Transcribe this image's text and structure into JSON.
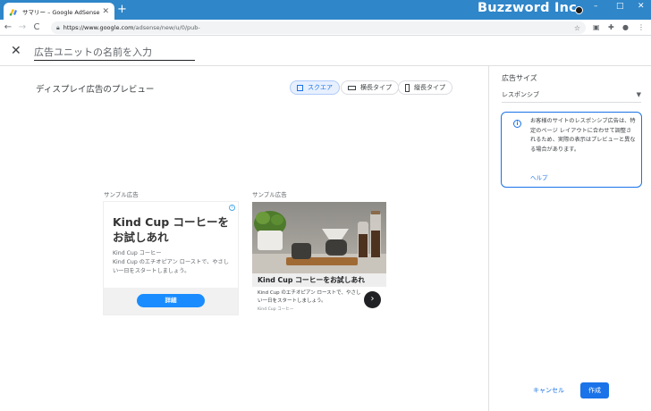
{
  "browser": {
    "tab_title": "サマリー – Google AdSense",
    "new_tab_symbol": "+",
    "url_domain": "https://www.google.com",
    "url_path": "/adsense/new/u/0/pub-",
    "brand_watermark": "Buzzword Inc.",
    "window_controls": [
      "–",
      "□",
      "✕"
    ],
    "nav": {
      "back": "←",
      "forward": "→",
      "reload": "C"
    }
  },
  "header": {
    "close_symbol": "✕",
    "name_placeholder": "広告ユニットの名前を入力"
  },
  "preview": {
    "title": "ディスプレイ広告のプレビュー",
    "shape_options": [
      {
        "label": "スクエア",
        "selected": true
      },
      {
        "label": "横長タイプ",
        "selected": false
      },
      {
        "label": "縦長タイプ",
        "selected": false
      }
    ],
    "samples": [
      {
        "label": "サンプル広告",
        "headline": "Kind Cup コーヒーを お試しあれ",
        "advertiser": "Kind Cup コーヒー",
        "description": "Kind Cup のエチオピアン ローストで、やさしい一日をスタートしましょう。",
        "button": "詳細"
      },
      {
        "label": "サンプル広告",
        "headline": "Kind Cup コーヒーをお試しあれ",
        "description": "Kind Cup のエチオピアン ローストで、やさしい一日をスタートしましょう。",
        "advertiser": "Kind Cup コーヒー",
        "arrow": "›"
      }
    ]
  },
  "settings": {
    "size_title": "広告サイズ",
    "size_value": "レスポンシブ",
    "info_text": "お客様のサイトのレスポンシブ広告は、特定のページ レイアウトに合わせて調整されるため、実際の表示はプレビューと異なる場合があります。",
    "help_link": "ヘルプ",
    "cancel": "キャンセル",
    "create": "作成"
  },
  "colors": {
    "titlebar": "#2f86c9",
    "accent": "#1a73e8",
    "ad_button": "#1a8cff"
  }
}
